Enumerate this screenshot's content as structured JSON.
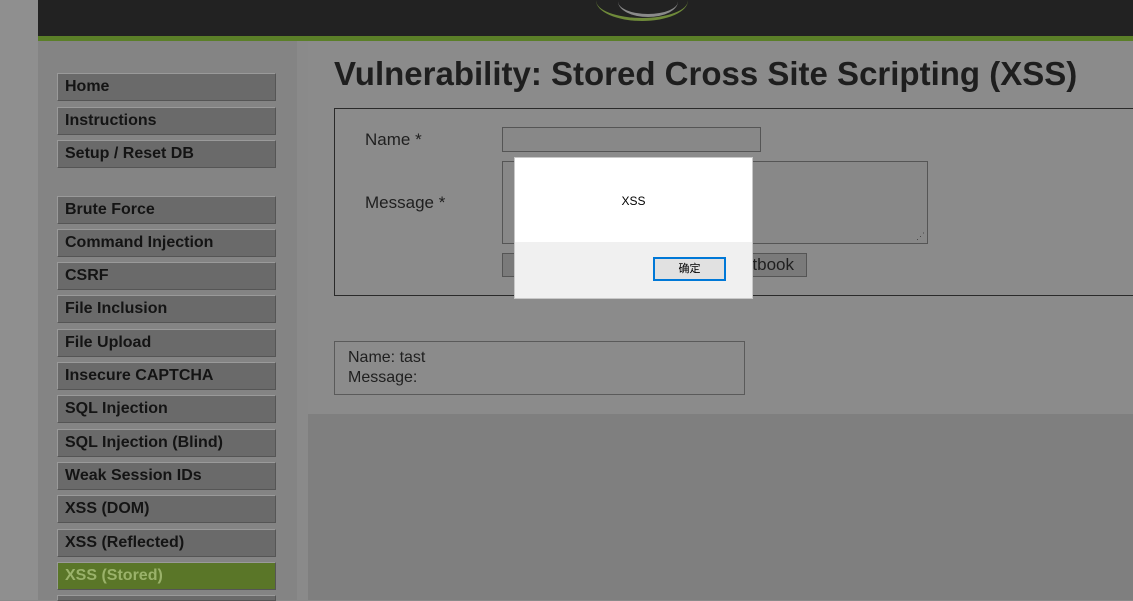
{
  "page": {
    "title": "Vulnerability: Stored Cross Site Scripting (XSS)"
  },
  "menu": {
    "group1": [
      "Home",
      "Instructions",
      "Setup / Reset DB"
    ],
    "group2": [
      "Brute Force",
      "Command Injection",
      "CSRF",
      "File Inclusion",
      "File Upload",
      "Insecure CAPTCHA",
      "SQL Injection",
      "SQL Injection (Blind)",
      "Weak Session IDs",
      "XSS (DOM)",
      "XSS (Reflected)",
      "XSS (Stored)"
    ],
    "active": "XSS (Stored)"
  },
  "form": {
    "name_label": "Name *",
    "name_value": "",
    "message_label": "Message *",
    "message_value": "",
    "submit_label_visible": "tbook"
  },
  "entry": {
    "name_line": "Name: tast",
    "message_line": "Message:"
  },
  "dialog": {
    "message": "XSS",
    "ok_label": "确定"
  },
  "colors": {
    "header": "#222222",
    "accent_stripe": "#5b7f28",
    "active_menu": "#5a7628",
    "dialog_focus": "#0078d7"
  }
}
